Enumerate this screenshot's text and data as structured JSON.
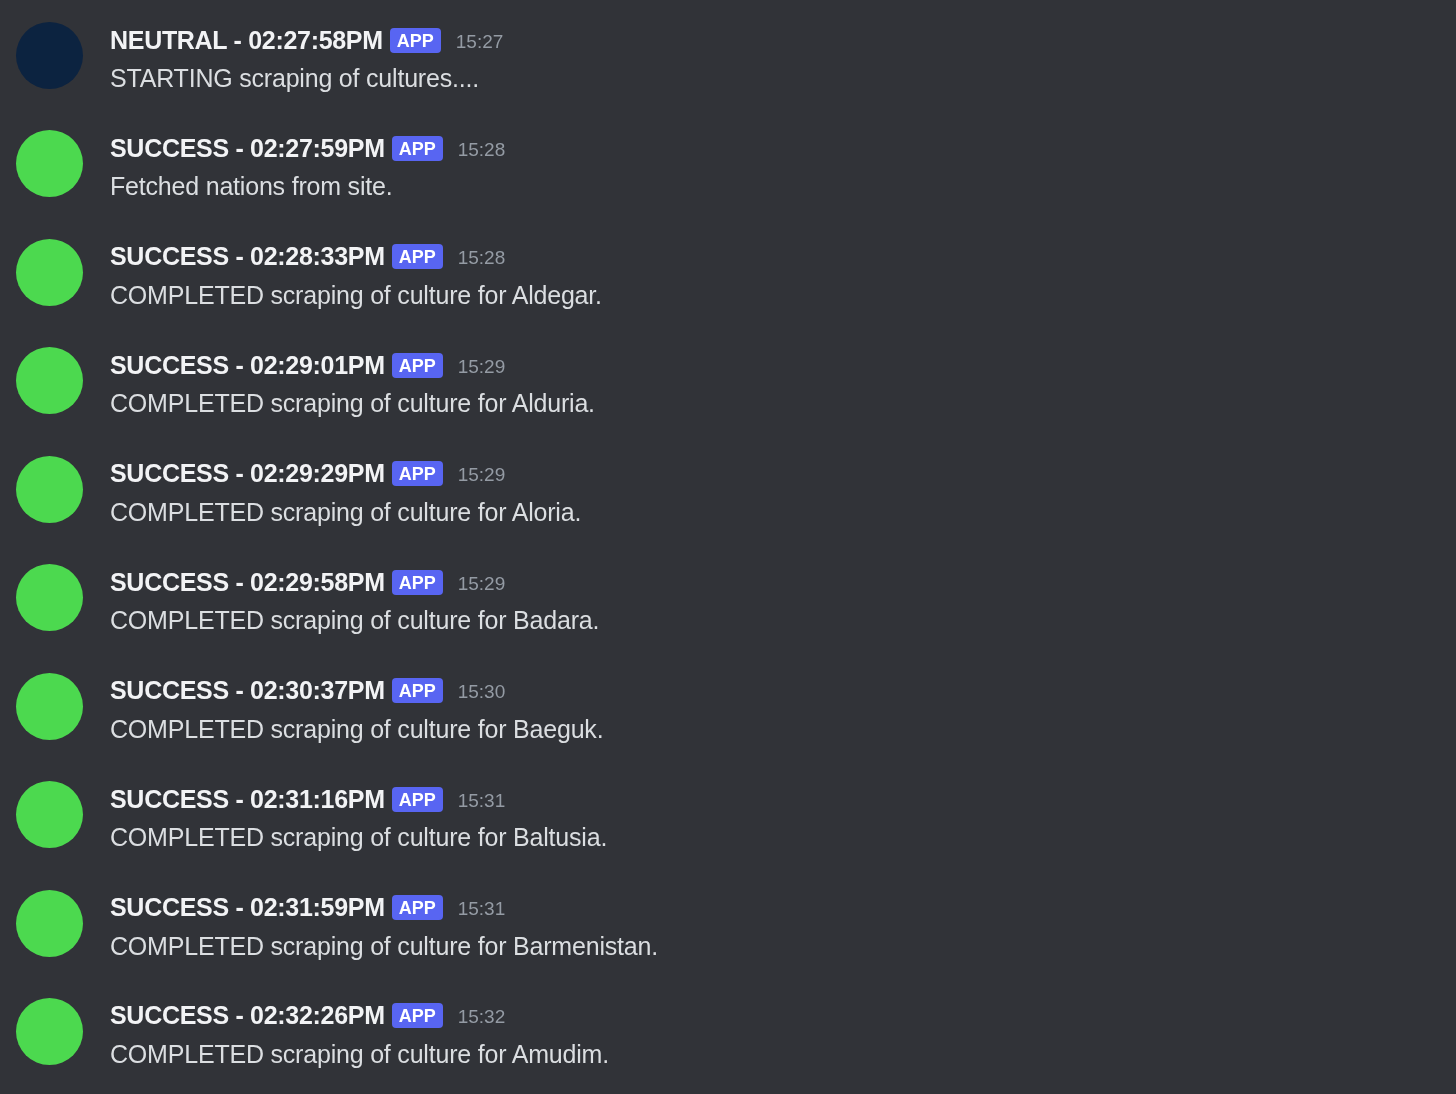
{
  "messages": [
    {
      "author": "NEUTRAL - 02:27:58PM",
      "badge": "APP",
      "time": "15:27",
      "text": "STARTING scraping of cultures....",
      "color": "#0c2340"
    },
    {
      "author": "SUCCESS - 02:27:59PM",
      "badge": "APP",
      "time": "15:28",
      "text": "Fetched nations from site.",
      "color": "#4cd94f"
    },
    {
      "author": "SUCCESS - 02:28:33PM",
      "badge": "APP",
      "time": "15:28",
      "text": "COMPLETED scraping of culture for Aldegar.",
      "color": "#4cd94f"
    },
    {
      "author": "SUCCESS - 02:29:01PM",
      "badge": "APP",
      "time": "15:29",
      "text": "COMPLETED scraping of culture for Alduria.",
      "color": "#4cd94f"
    },
    {
      "author": "SUCCESS - 02:29:29PM",
      "badge": "APP",
      "time": "15:29",
      "text": "COMPLETED scraping of culture for Aloria.",
      "color": "#4cd94f"
    },
    {
      "author": "SUCCESS - 02:29:58PM",
      "badge": "APP",
      "time": "15:29",
      "text": "COMPLETED scraping of culture for Badara.",
      "color": "#4cd94f"
    },
    {
      "author": "SUCCESS - 02:30:37PM",
      "badge": "APP",
      "time": "15:30",
      "text": "COMPLETED scraping of culture for Baeguk.",
      "color": "#4cd94f"
    },
    {
      "author": "SUCCESS - 02:31:16PM",
      "badge": "APP",
      "time": "15:31",
      "text": "COMPLETED scraping of culture for Baltusia.",
      "color": "#4cd94f"
    },
    {
      "author": "SUCCESS - 02:31:59PM",
      "badge": "APP",
      "time": "15:31",
      "text": "COMPLETED scraping of culture for Barmenistan.",
      "color": "#4cd94f"
    },
    {
      "author": "SUCCESS - 02:32:26PM",
      "badge": "APP",
      "time": "15:32",
      "text": "COMPLETED scraping of culture for Amudim.",
      "color": "#4cd94f"
    }
  ]
}
